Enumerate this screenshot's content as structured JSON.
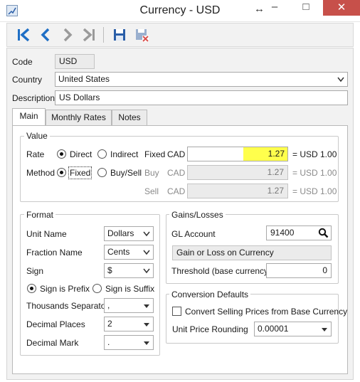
{
  "window": {
    "title": "Currency - USD",
    "minimize_glyph": "‒",
    "maximize_glyph": "□",
    "close_glyph": "✕",
    "resize_glyph": "↔"
  },
  "toolbar": {
    "icons": [
      "first-record-icon",
      "previous-record-icon",
      "next-record-icon",
      "last-record-icon",
      "save-icon",
      "save-close-icon"
    ],
    "accent_color": "#1f6fc5",
    "save_color": "#2a5ea8",
    "delete_color": "#d9534f"
  },
  "fields": {
    "code_label": "Code",
    "code_value": "USD",
    "country_label": "Country",
    "country_value": "United States",
    "description_label": "Description",
    "description_value": "US Dollars"
  },
  "tabs": [
    {
      "label": "Main",
      "active": true
    },
    {
      "label": "Monthly Rates",
      "active": false
    },
    {
      "label": "Notes",
      "active": false
    }
  ],
  "value_group": {
    "title": "Value",
    "rate_label": "Rate",
    "rate_direct": "Direct",
    "rate_indirect": "Indirect",
    "rate_selected": "Direct",
    "method_label": "Method",
    "method_fixed": "Fixed",
    "method_buysell": "Buy/Sell",
    "method_selected": "Fixed",
    "fixed_label": "Fixed",
    "buy_label": "Buy",
    "sell_label": "Sell",
    "currency_code": "CAD",
    "fixed_value": "1.27",
    "buy_value": "1.27",
    "sell_value": "1.27",
    "equals_text": "= USD 1.00",
    "highlight_color": "#ffff4c"
  },
  "format_group": {
    "title": "Format",
    "unit_name_label": "Unit Name",
    "unit_name_value": "Dollars",
    "fraction_name_label": "Fraction Name",
    "fraction_name_value": "Cents",
    "sign_label": "Sign",
    "sign_value": "$",
    "sign_prefix": "Sign is Prefix",
    "sign_suffix": "Sign is Suffix",
    "sign_selected": "Sign is Prefix",
    "thousands_label": "Thousands Separator",
    "thousands_value": ",",
    "decimal_places_label": "Decimal Places",
    "decimal_places_value": "2",
    "decimal_mark_label": "Decimal Mark",
    "decimal_mark_value": "."
  },
  "gains_group": {
    "title": "Gains/Losses",
    "gl_account_label": "GL Account",
    "gl_account_value": "91400",
    "gl_account_description": "Gain or Loss on Currency",
    "threshold_label": "Threshold (base currency)",
    "threshold_value": "0"
  },
  "conversion_group": {
    "title": "Conversion Defaults",
    "convert_checkbox_label": "Convert Selling Prices from Base Currency",
    "convert_checked": false,
    "unit_price_rounding_label": "Unit Price Rounding",
    "unit_price_rounding_value": "0.00001"
  }
}
